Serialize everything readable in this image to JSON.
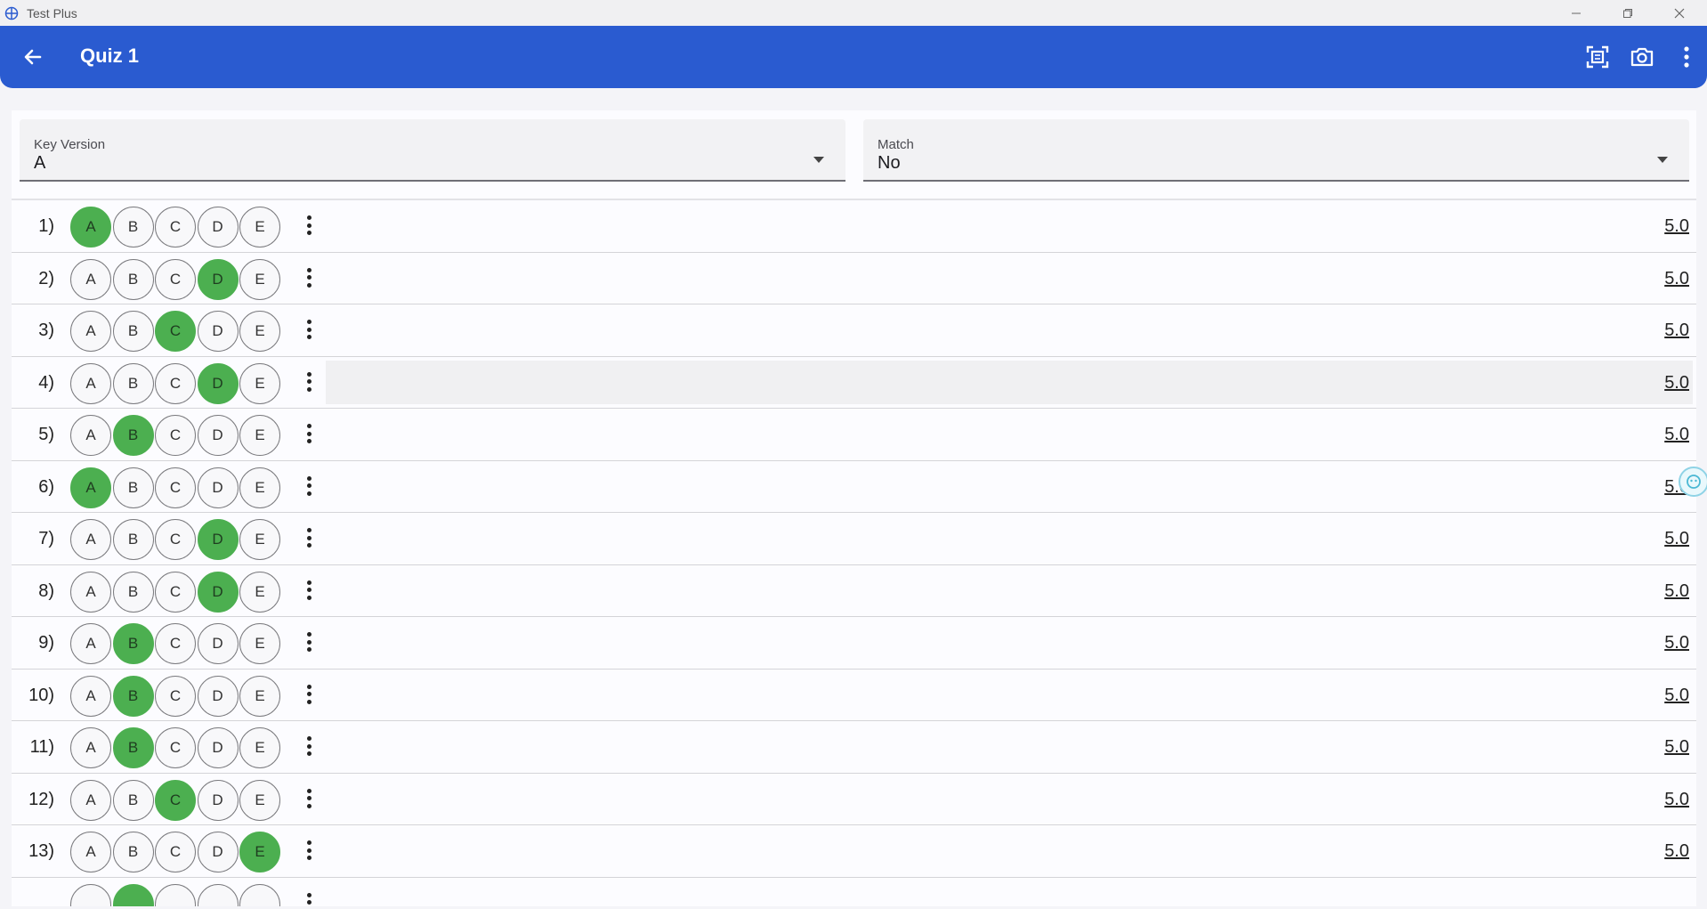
{
  "window": {
    "title": "Test Plus"
  },
  "appbar": {
    "title": "Quiz 1",
    "back_icon": "arrow-left-icon",
    "actions": [
      "scan-frame-icon",
      "camera-icon",
      "more-vert-icon"
    ]
  },
  "filters": {
    "key_version": {
      "label": "Key Version",
      "value": "A"
    },
    "match": {
      "label": "Match",
      "value": "No"
    }
  },
  "options": [
    "A",
    "B",
    "C",
    "D",
    "E"
  ],
  "colors": {
    "accent": "#2a5bd0",
    "selected": "#4caf50"
  },
  "questions": [
    {
      "num": "1)",
      "selected": "A",
      "score": "5.0"
    },
    {
      "num": "2)",
      "selected": "D",
      "score": "5.0"
    },
    {
      "num": "3)",
      "selected": "C",
      "score": "5.0"
    },
    {
      "num": "4)",
      "selected": "D",
      "score": "5.0"
    },
    {
      "num": "5)",
      "selected": "B",
      "score": "5.0"
    },
    {
      "num": "6)",
      "selected": "A",
      "score": "5.0"
    },
    {
      "num": "7)",
      "selected": "D",
      "score": "5.0"
    },
    {
      "num": "8)",
      "selected": "D",
      "score": "5.0"
    },
    {
      "num": "9)",
      "selected": "B",
      "score": "5.0"
    },
    {
      "num": "10)",
      "selected": "B",
      "score": "5.0"
    },
    {
      "num": "11)",
      "selected": "B",
      "score": "5.0"
    },
    {
      "num": "12)",
      "selected": "C",
      "score": "5.0"
    },
    {
      "num": "13)",
      "selected": "E",
      "score": "5.0"
    }
  ],
  "partial_row": {
    "selected": "B"
  }
}
